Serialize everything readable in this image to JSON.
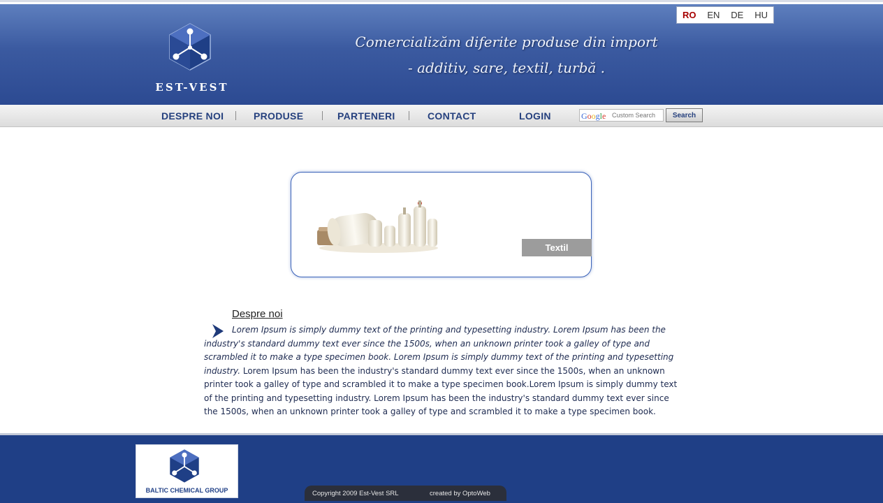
{
  "header": {
    "logo_text": "EST-VEST",
    "tagline_line1": "Comercializăm diferite produse din import",
    "tagline_line2": "- additiv, sare, textil, turbă ."
  },
  "languages": [
    {
      "code": "RO",
      "active": true
    },
    {
      "code": "EN",
      "active": false
    },
    {
      "code": "DE",
      "active": false
    },
    {
      "code": "HU",
      "active": false
    }
  ],
  "nav": {
    "items": [
      "DESPRE NOI",
      "PRODUSE",
      "PARTENERI",
      "CONTACT"
    ],
    "login": "LOGIN"
  },
  "search": {
    "placeholder": "Custom Search",
    "brand": "Google",
    "button": "Search"
  },
  "feature": {
    "label": "Textil",
    "image_icon": "textile-spools-icon"
  },
  "content": {
    "title": "Despre noi",
    "paragraph_italic": "Lorem Ipsum is simply dummy text of the printing and typesetting industry. Lorem Ipsum has been the industry's standard dummy text ever since the 1500s, when an unknown printer took a galley of type and scrambled it to make a type specimen book.",
    "paragraph_mixed_italic": "Lorem Ipsum is simply dummy text of the printing and typesetting industry.",
    "paragraph_rest": " Lorem Ipsum has been the industry's standard dummy text ever since the 1500s, when an unknown printer took a galley of type and scrambled it to make a type specimen book.Lorem Ipsum is simply dummy text of the printing and typesetting industry. Lorem Ipsum has been the industry's standard dummy text ever since the 1500s, when an unknown printer took a galley of type and scrambled it to make a type specimen book."
  },
  "footer": {
    "partner_text": "BALTIC CHEMICAL GROUP",
    "copyright": "Copyright 2009 Est-Vest SRL",
    "created_by": "created by  OptoWeb"
  },
  "colors": {
    "header_blue": "#3b5aa0",
    "nav_text": "#25407e",
    "footer_blue": "#1f3f86",
    "active_lang": "#a60000"
  }
}
